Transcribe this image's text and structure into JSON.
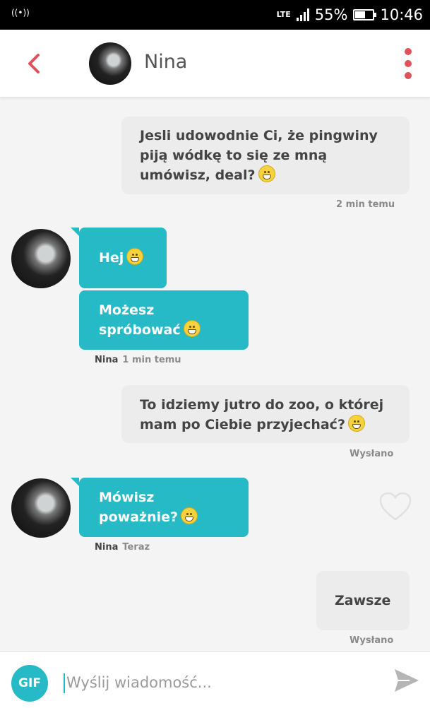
{
  "status_bar": {
    "network": "LTE",
    "battery": "55%",
    "battery_level": 0.55,
    "time": "10:46"
  },
  "header": {
    "contact_name": "Nina"
  },
  "messages": [
    {
      "from": "me",
      "lines": [
        "Jesli udowodnie Ci, że pingwiny",
        "piją wódkę to się ze mną",
        "umówisz, deal?"
      ],
      "emoji": "grimacing-emoji",
      "meta": "2 min temu"
    },
    {
      "from": "Nina",
      "lines": [
        "Hej"
      ],
      "emoji": "grinning-emoji"
    },
    {
      "from": "Nina",
      "lines": [
        "Możesz",
        "spróbować"
      ],
      "emoji": "grinning-emoji",
      "meta_name": "Nina",
      "meta": "1 min temu"
    },
    {
      "from": "me",
      "lines": [
        "To idziemy jutro do zoo, o której",
        "mam po Ciebie przyjechać?"
      ],
      "emoji": "grimacing-emoji",
      "meta": "Wysłano"
    },
    {
      "from": "Nina",
      "lines": [
        "Mówisz",
        "poważnie?"
      ],
      "emoji": "grinning-emoji",
      "meta_name": "Nina",
      "meta": "Teraz"
    },
    {
      "from": "me",
      "lines": [
        "Zawsze"
      ],
      "meta": "Wysłano"
    }
  ],
  "composer": {
    "gif_label": "GIF",
    "placeholder": "Wyślij wiadomość..."
  },
  "colors": {
    "accent": "#26b9c6",
    "header_icons": "#e0525a",
    "sent_bubble": "#ececec"
  }
}
